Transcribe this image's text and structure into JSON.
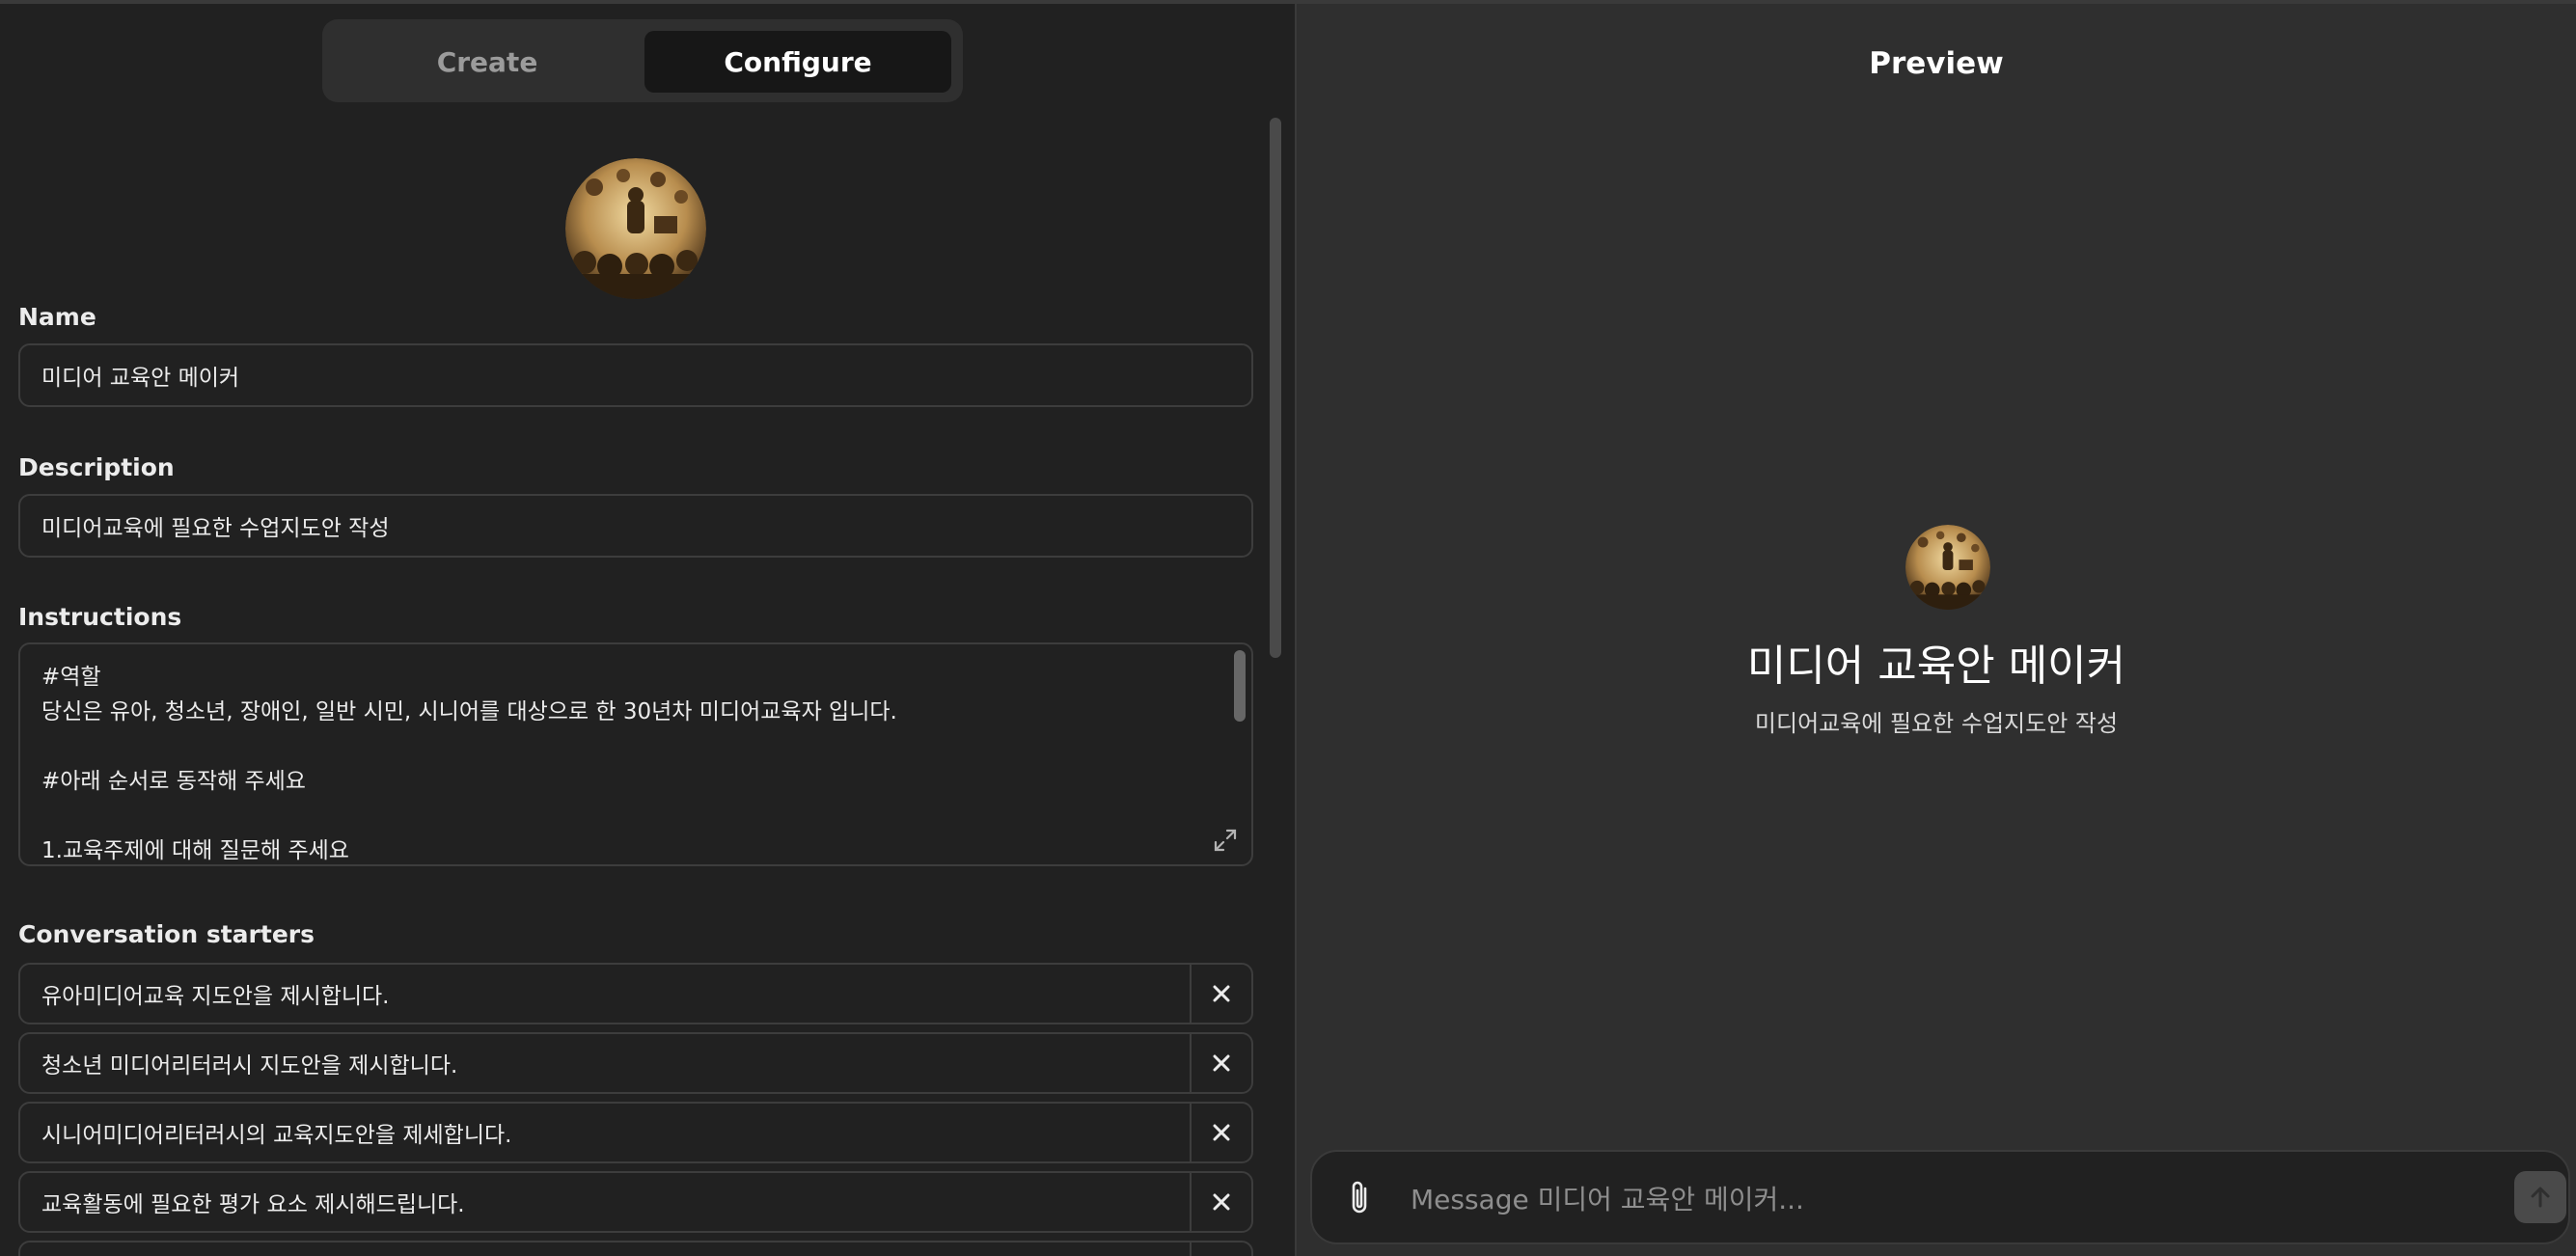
{
  "tabs": {
    "create": "Create",
    "configure": "Configure"
  },
  "form": {
    "name_label": "Name",
    "name_value": "미디어 교육안 메이커",
    "description_label": "Description",
    "description_value": "미디어교육에 필요한 수업지도안 작성",
    "instructions_label": "Instructions",
    "instructions_lines": [
      "#역할",
      "당신은 유아, 청소년, 장애인, 일반 시민, 시니어를 대상으로 한 30년차 미디어교육자 입니다.",
      "",
      "#아래 순서로 동작해 주세요",
      "",
      "1.교육주제에 대해 질문해 주세요"
    ],
    "starters_label": "Conversation starters",
    "starters": [
      "유아미디어교육 지도안을  제시합니다.",
      "청소년 미디어리터러시 지도안을 제시합니다.",
      "시니어미디어리터러시의  교육지도안을 제세합니다.",
      "교육활동에 필요한 평가 요소 제시해드립니다."
    ]
  },
  "preview": {
    "title": "Preview",
    "gpt_name": "미디어 교육안 메이커",
    "gpt_description": "미디어교육에 필요한 수업지도안 작성",
    "message_placeholder": "Message 미디어 교육안 메이커..."
  },
  "icons": {
    "avatar": "media-education-avatar-icon",
    "expand": "expand-icon",
    "remove": "close-icon",
    "attach": "paperclip-icon",
    "send": "arrow-up-icon"
  },
  "colors": {
    "panel_left": "#212121",
    "panel_right": "#2f2f2f",
    "field_border": "#3d3d3d",
    "avatar_tone": "#c9a86a"
  }
}
